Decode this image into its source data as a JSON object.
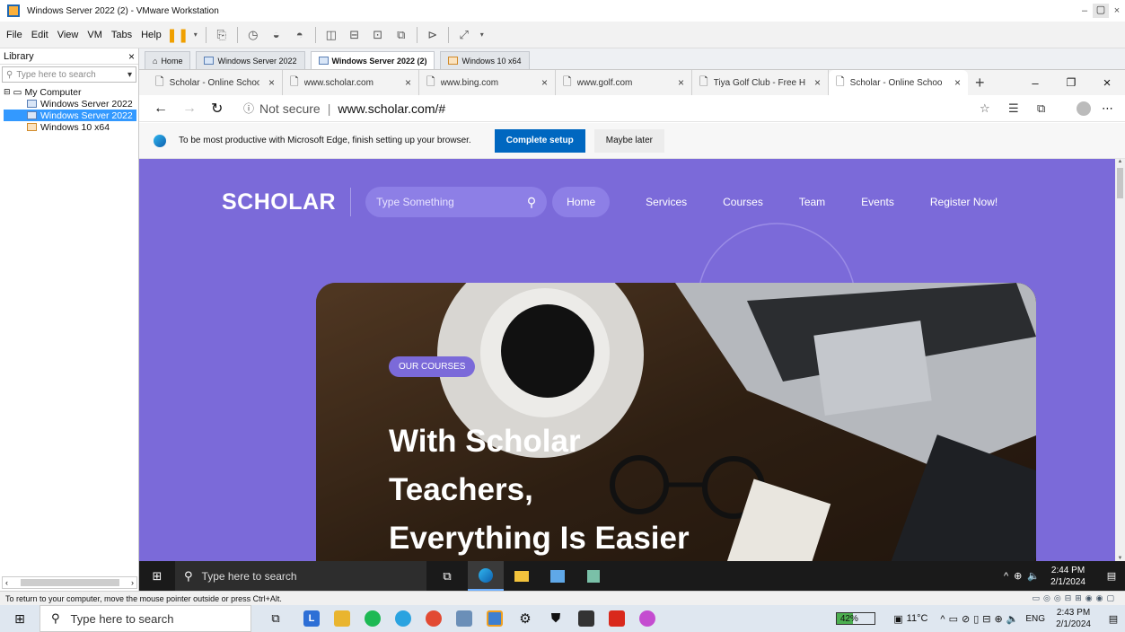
{
  "window": {
    "title": "Windows Server 2022 (2) - VMware Workstation"
  },
  "menu": {
    "items": [
      "File",
      "Edit",
      "View",
      "VM",
      "Tabs",
      "Help"
    ]
  },
  "library": {
    "title": "Library",
    "search_placeholder": "Type here to search",
    "tree": {
      "root": "My Computer",
      "vms": [
        "Windows Server 2022",
        "Windows Server 2022",
        "Windows 10 x64"
      ]
    }
  },
  "vm_tabs": [
    "Home",
    "Windows Server 2022",
    "Windows Server 2022 (2)",
    "Windows 10 x64"
  ],
  "browser": {
    "tabs": [
      "Scholar - Online Schoo",
      "www.scholar.com",
      "www.bing.com",
      "www.golf.com",
      "Tiya Golf Club - Free H",
      "Scholar - Online Schoo"
    ],
    "security": "Not secure",
    "url": "www.scholar.com/#",
    "infobar": {
      "message": "To be most productive with Microsoft Edge, finish setting up your browser.",
      "primary": "Complete setup",
      "secondary": "Maybe later"
    }
  },
  "site": {
    "logo": "SCHOLAR",
    "search_placeholder": "Type Something",
    "nav": [
      "Home",
      "Services",
      "Courses",
      "Team",
      "Events",
      "Register Now!"
    ],
    "badge": "OUR COURSES",
    "headline": [
      "With Scholar",
      "Teachers,",
      "Everything Is Easier"
    ]
  },
  "vm_taskbar": {
    "search_placeholder": "Type here to search",
    "time": "2:44 PM",
    "date": "2/1/2024"
  },
  "status": {
    "message": "To return to your computer, move the mouse pointer outside or press Ctrl+Alt."
  },
  "host_taskbar": {
    "search_placeholder": "Type here to search",
    "battery": "42%",
    "weather": "11°C",
    "lang": "ENG",
    "time": "2:43 PM",
    "date": "2/1/2024"
  },
  "colors": {
    "site_bg": "#7b6ad9",
    "accent_blue": "#0067c0",
    "pill": "#8d7fe6"
  }
}
